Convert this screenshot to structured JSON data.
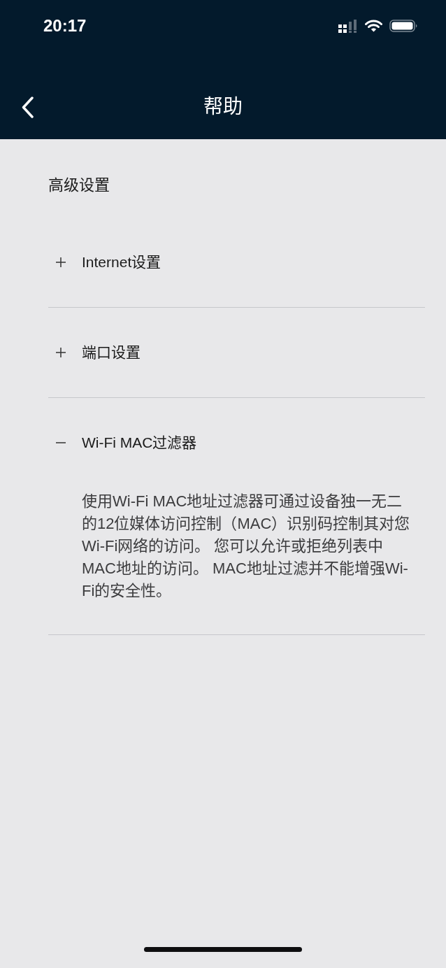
{
  "status_bar": {
    "time": "20:17"
  },
  "nav_bar": {
    "title": "帮助"
  },
  "section": {
    "title": "高级设置",
    "items": [
      {
        "label": "Internet设置",
        "expanded": false
      },
      {
        "label": "端口设置",
        "expanded": false
      },
      {
        "label": "Wi-Fi MAC过滤器",
        "expanded": true,
        "description": "使用Wi-Fi MAC地址过滤器可通过设备独一无二的12位媒体访问控制（MAC）识别码控制其对您Wi-Fi网络的访问。 您可以允许或拒绝列表中MAC地址的访问。 MAC地址过滤并不能增强Wi-Fi的安全性。"
      }
    ]
  }
}
